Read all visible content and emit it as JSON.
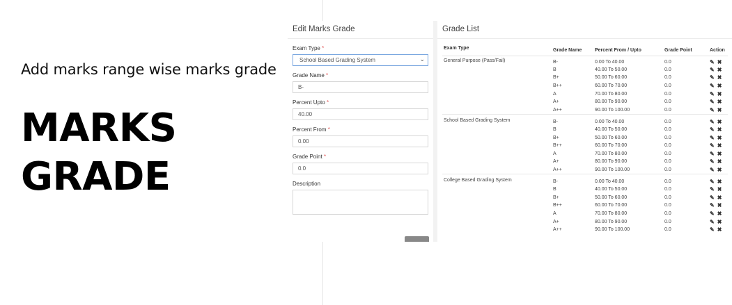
{
  "promo": {
    "subtitle": "Add marks range wise marks grade",
    "title_line1": "MARKS",
    "title_line2": "GRADE"
  },
  "form": {
    "title": "Edit Marks Grade",
    "exam_type_label": "Exam Type",
    "exam_type_value": "School Based Grading System",
    "grade_name_label": "Grade Name",
    "grade_name_value": "B-",
    "percent_upto_label": "Percent Upto",
    "percent_upto_value": "40.00",
    "percent_from_label": "Percent From",
    "percent_from_value": "0.00",
    "grade_point_label": "Grade Point",
    "grade_point_value": "0.0",
    "description_label": "Description",
    "description_value": "",
    "required_mark": "*"
  },
  "list": {
    "title": "Grade List",
    "columns": [
      "Exam Type",
      "Grade Name",
      "Percent From / Upto",
      "Grade Point",
      "Action"
    ],
    "groups": [
      {
        "exam_type": "General Purpose (Pass/Fail)",
        "rows": [
          {
            "grade": "B-",
            "range": "0.00 To 40.00",
            "point": "0.0"
          },
          {
            "grade": "B",
            "range": "40.00 To 50.00",
            "point": "0.0"
          },
          {
            "grade": "B+",
            "range": "50.00 To 60.00",
            "point": "0.0"
          },
          {
            "grade": "B++",
            "range": "60.00 To 70.00",
            "point": "0.0"
          },
          {
            "grade": "A",
            "range": "70.00 To 80.00",
            "point": "0.0"
          },
          {
            "grade": "A+",
            "range": "80.00 To 90.00",
            "point": "0.0"
          },
          {
            "grade": "A++",
            "range": "90.00 To 100.00",
            "point": "0.0"
          }
        ]
      },
      {
        "exam_type": "School Based Grading System",
        "rows": [
          {
            "grade": "B-",
            "range": "0.00 To 40.00",
            "point": "0.0"
          },
          {
            "grade": "B",
            "range": "40.00 To 50.00",
            "point": "0.0"
          },
          {
            "grade": "B+",
            "range": "50.00 To 60.00",
            "point": "0.0"
          },
          {
            "grade": "B++",
            "range": "60.00 To 70.00",
            "point": "0.0"
          },
          {
            "grade": "A",
            "range": "70.00 To 80.00",
            "point": "0.0"
          },
          {
            "grade": "A+",
            "range": "80.00 To 90.00",
            "point": "0.0"
          },
          {
            "grade": "A++",
            "range": "90.00 To 100.00",
            "point": "0.0"
          }
        ]
      },
      {
        "exam_type": "College Based Grading System",
        "rows": [
          {
            "grade": "B-",
            "range": "0.00 To 40.00",
            "point": "0.0"
          },
          {
            "grade": "B",
            "range": "40.00 To 50.00",
            "point": "0.0"
          },
          {
            "grade": "B+",
            "range": "50.00 To 60.00",
            "point": "0.0"
          },
          {
            "grade": "B++",
            "range": "60.00 To 70.00",
            "point": "0.0"
          },
          {
            "grade": "A",
            "range": "70.00 To 80.00",
            "point": "0.0"
          },
          {
            "grade": "A+",
            "range": "80.00 To 90.00",
            "point": "0.0"
          },
          {
            "grade": "A++",
            "range": "90.00 To 100.00",
            "point": "0.0"
          }
        ]
      }
    ],
    "action_icons": [
      "pencil-icon",
      "close-icon"
    ]
  }
}
